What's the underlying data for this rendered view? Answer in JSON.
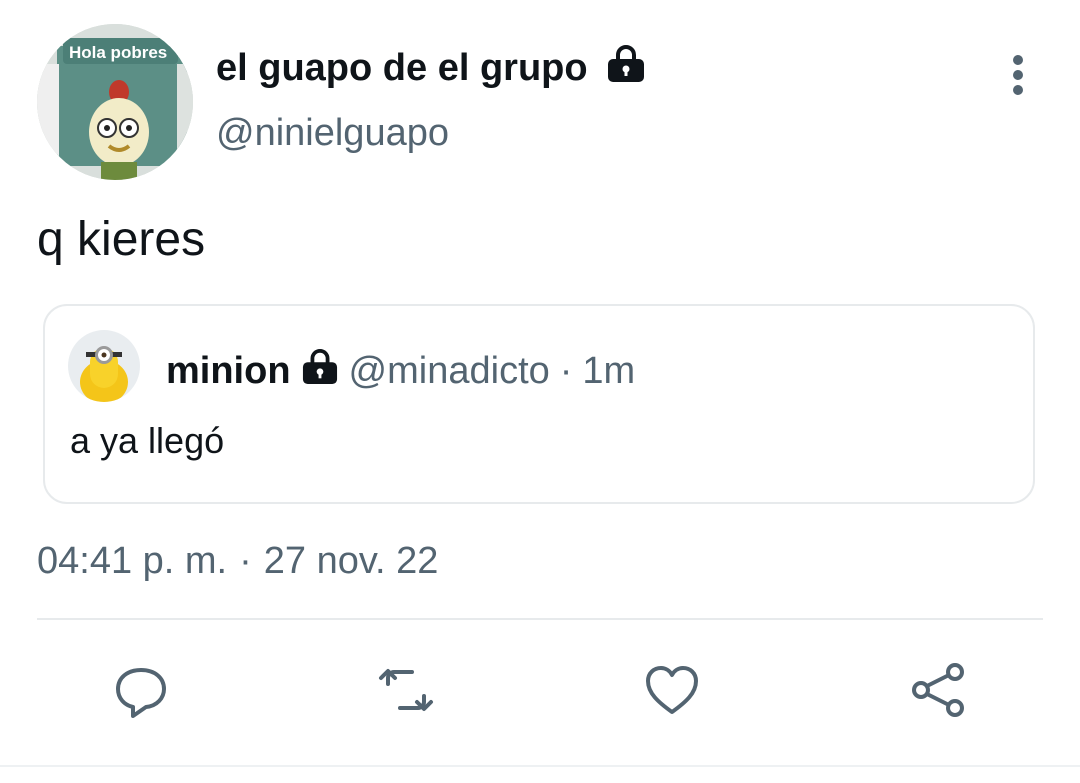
{
  "author": {
    "display_name": "el guapo de el grupo",
    "handle": "@ninielguapo",
    "avatar_caption": "Hola pobres",
    "protected_icon": "lock-icon"
  },
  "tweet": {
    "text": "q kieres",
    "time": "04:41 p. m.",
    "separator": "·",
    "date": "27 nov. 22"
  },
  "quoted_tweet": {
    "display_name": "minion",
    "handle": "@minadicto",
    "separator": "·",
    "relative_time": "1m",
    "text": "a ya llegó",
    "protected_icon": "lock-icon"
  },
  "actions": [
    {
      "name": "reply",
      "icon": "reply-icon"
    },
    {
      "name": "retweet",
      "icon": "retweet-icon"
    },
    {
      "name": "like",
      "icon": "heart-icon"
    },
    {
      "name": "share",
      "icon": "share-icon"
    }
  ],
  "more_icon": "more-vertical-icon",
  "colors": {
    "text_primary": "#0f1419",
    "text_secondary": "#536471",
    "border": "#e7eaec",
    "background": "#ffffff"
  }
}
